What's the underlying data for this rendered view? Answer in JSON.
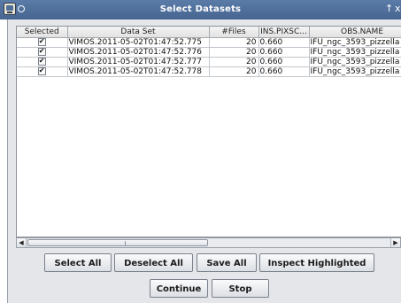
{
  "window": {
    "title": "Select Datasets",
    "title_glyph_up": "↑",
    "title_glyph_close": "x"
  },
  "table": {
    "columns": [
      "Selected",
      "Data Set",
      "#Files",
      "INS.PIXSC...",
      "OBS.NAME"
    ],
    "rows": [
      {
        "selected": true,
        "data_set": "VIMOS.2011-05-02T01:47:52.775",
        "files": "20",
        "pixsc": "0.660",
        "obs_name": "IFU_ngc_3593_pizzella"
      },
      {
        "selected": true,
        "data_set": "VIMOS.2011-05-02T01:47:52.776",
        "files": "20",
        "pixsc": "0.660",
        "obs_name": "IFU_ngc_3593_pizzella"
      },
      {
        "selected": true,
        "data_set": "VIMOS.2011-05-02T01:47:52.777",
        "files": "20",
        "pixsc": "0.660",
        "obs_name": "IFU_ngc_3593_pizzella"
      },
      {
        "selected": true,
        "data_set": "VIMOS.2011-05-02T01:47:52.778",
        "files": "20",
        "pixsc": "0.660",
        "obs_name": "IFU_ngc_3593_pizzella"
      }
    ]
  },
  "scrollbar": {
    "left_arrow": "◀",
    "right_arrow": "▶"
  },
  "buttons": {
    "select_all": "Select All",
    "deselect_all": "Deselect All",
    "save_all": "Save All",
    "inspect_highlighted": "Inspect Highlighted",
    "continue": "Continue",
    "stop": "Stop"
  },
  "icons": {
    "app": "app-window-icon",
    "menu": "window-menu-icon",
    "up": "arrow-up-icon",
    "close": "close-icon"
  }
}
